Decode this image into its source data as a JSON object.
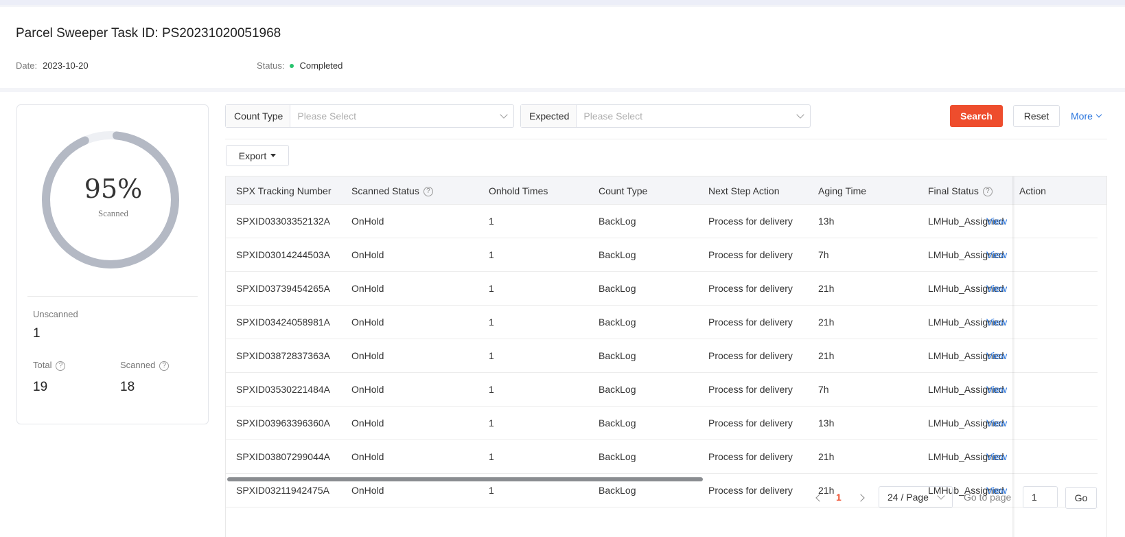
{
  "header": {
    "title": "Parcel Sweeper Task ID: PS20231020051968",
    "date_label": "Date:",
    "date_value": "2023-10-20",
    "status_label": "Status:",
    "status_value": "Completed",
    "status_color": "#28c36d"
  },
  "summary": {
    "percent": 0.95,
    "percent_text": "95%",
    "percent_label": "Scanned",
    "unscanned_label": "Unscanned",
    "unscanned_value": "1",
    "total_label": "Total",
    "total_value": "19",
    "scanned_label": "Scanned",
    "scanned_value": "18"
  },
  "filters": {
    "count_type_label": "Count Type",
    "count_type_placeholder": "Please Select",
    "expected_label": "Expected",
    "expected_placeholder": "Please Select",
    "search_label": "Search",
    "reset_label": "Reset",
    "more_label": "More",
    "export_label": "Export"
  },
  "table": {
    "columns": [
      "SPX Tracking Number",
      "Scanned Status",
      "Onhold Times",
      "Count Type",
      "Next Step Action",
      "Aging Time",
      "Final Status",
      "Action"
    ],
    "rows": [
      [
        "SPXID03303352132A",
        "OnHold",
        "1",
        "BackLog",
        "Process for delivery",
        "13h",
        "LMHub_Assigned",
        "View"
      ],
      [
        "SPXID03014244503A",
        "OnHold",
        "1",
        "BackLog",
        "Process for delivery",
        "7h",
        "LMHub_Assigned",
        "View"
      ],
      [
        "SPXID03739454265A",
        "OnHold",
        "1",
        "BackLog",
        "Process for delivery",
        "21h",
        "LMHub_Assigned",
        "View"
      ],
      [
        "SPXID03424058981A",
        "OnHold",
        "1",
        "BackLog",
        "Process for delivery",
        "21h",
        "LMHub_Assigned",
        "View"
      ],
      [
        "SPXID03872837363A",
        "OnHold",
        "1",
        "BackLog",
        "Process for delivery",
        "21h",
        "LMHub_Assigned",
        "View"
      ],
      [
        "SPXID03530221484A",
        "OnHold",
        "1",
        "BackLog",
        "Process for delivery",
        "7h",
        "LMHub_Assigned",
        "View"
      ],
      [
        "SPXID03963396360A",
        "OnHold",
        "1",
        "BackLog",
        "Process for delivery",
        "13h",
        "LMHub_Assigned",
        "View"
      ],
      [
        "SPXID03807299044A",
        "OnHold",
        "1",
        "BackLog",
        "Process for delivery",
        "21h",
        "LMHub_Assigned",
        "View"
      ],
      [
        "SPXID03211942475A",
        "OnHold",
        "1",
        "BackLog",
        "Process for delivery",
        "21h",
        "LMHub_Assigned",
        "View"
      ]
    ]
  },
  "pagination": {
    "current_page": "1",
    "page_size": "24 / Page",
    "goto_label": "Go to page",
    "goto_value": "1",
    "go_label": "Go"
  },
  "colors": {
    "accent": "#ee4d2d",
    "link": "#2673dd",
    "ring": "#b4b9c4",
    "ring_track": "#eef0f4"
  }
}
